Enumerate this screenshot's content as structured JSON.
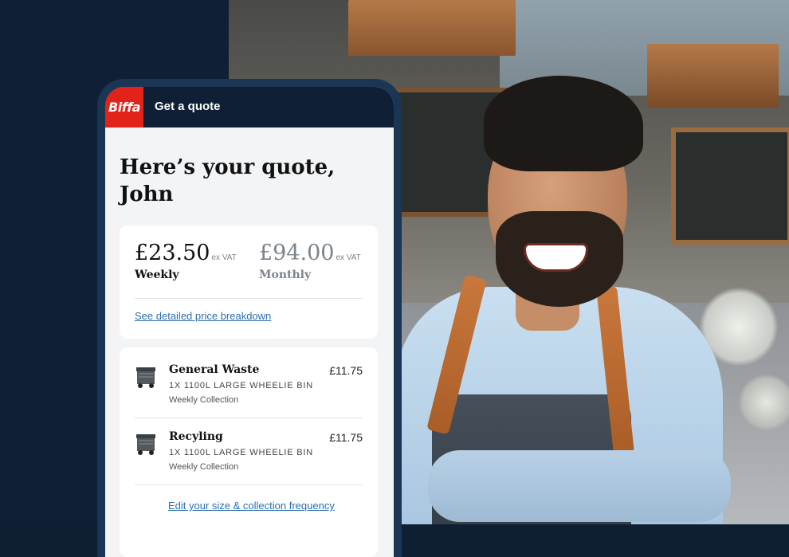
{
  "colors": {
    "brand_red": "#e2231a",
    "navy": "#0f2036",
    "link_blue": "#2a6fb0"
  },
  "header": {
    "logo_text": "Biffa",
    "title": "Get a quote"
  },
  "greeting": "Here’s your quote, John",
  "prices": [
    {
      "amount": "£23.50",
      "suffix": "ex VAT",
      "period": "Weekly",
      "emphasis": true
    },
    {
      "amount": "£94.00",
      "suffix": "ex VAT",
      "period": "Monthly",
      "emphasis": false
    }
  ],
  "breakdown_link": "See detailed price breakdown",
  "items": [
    {
      "icon": "wheelie-bin-icon",
      "name": "General Waste",
      "size": "1X 1100L LARGE WHEELIE BIN",
      "frequency": "Weekly Collection",
      "price": "£11.75"
    },
    {
      "icon": "wheelie-bin-icon",
      "name": "Recyling",
      "size": "1X 1100L LARGE WHEELIE BIN",
      "frequency": "Weekly Collection",
      "price": "£11.75"
    }
  ],
  "edit_link": "Edit your size & collection frequency"
}
